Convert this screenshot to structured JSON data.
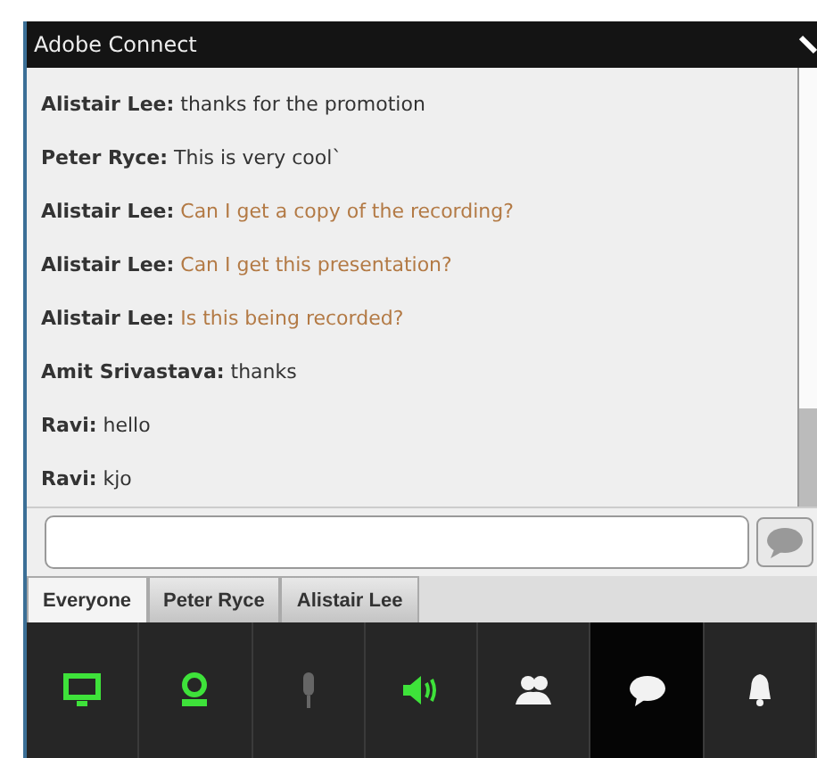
{
  "window": {
    "title": "Adobe Connect"
  },
  "messages": [
    {
      "sender": "Alistair Lee:",
      "text": "thanks for the promotion",
      "question": false
    },
    {
      "sender": "Peter Ryce:",
      "text": "This is very cool`",
      "question": false
    },
    {
      "sender": "Alistair Lee:",
      "text": "Can I get a copy of the recording?",
      "question": true
    },
    {
      "sender": "Alistair Lee:",
      "text": "Can I get this presentation?",
      "question": true
    },
    {
      "sender": "Alistair Lee:",
      "text": "Is this being recorded?",
      "question": true
    },
    {
      "sender": "Amit Srivastava:",
      "text": "thanks",
      "question": false
    },
    {
      "sender": "Ravi:",
      "text": "hello",
      "question": false
    },
    {
      "sender": "Ravi:",
      "text": "kjo",
      "question": false
    }
  ],
  "tabs": [
    {
      "label": "Everyone",
      "selected": true
    },
    {
      "label": "Peter Ryce",
      "selected": false
    },
    {
      "label": "Alistair Lee",
      "selected": false
    }
  ],
  "toolbar": [
    {
      "kind": "screen",
      "on": true,
      "selected": false
    },
    {
      "kind": "camera",
      "on": true,
      "selected": false
    },
    {
      "kind": "mic",
      "on": false,
      "selected": false
    },
    {
      "kind": "speaker",
      "on": true,
      "selected": false
    },
    {
      "kind": "people",
      "on": true,
      "selected": false
    },
    {
      "kind": "chat",
      "on": true,
      "selected": true
    },
    {
      "kind": "bell",
      "on": true,
      "selected": false
    }
  ]
}
